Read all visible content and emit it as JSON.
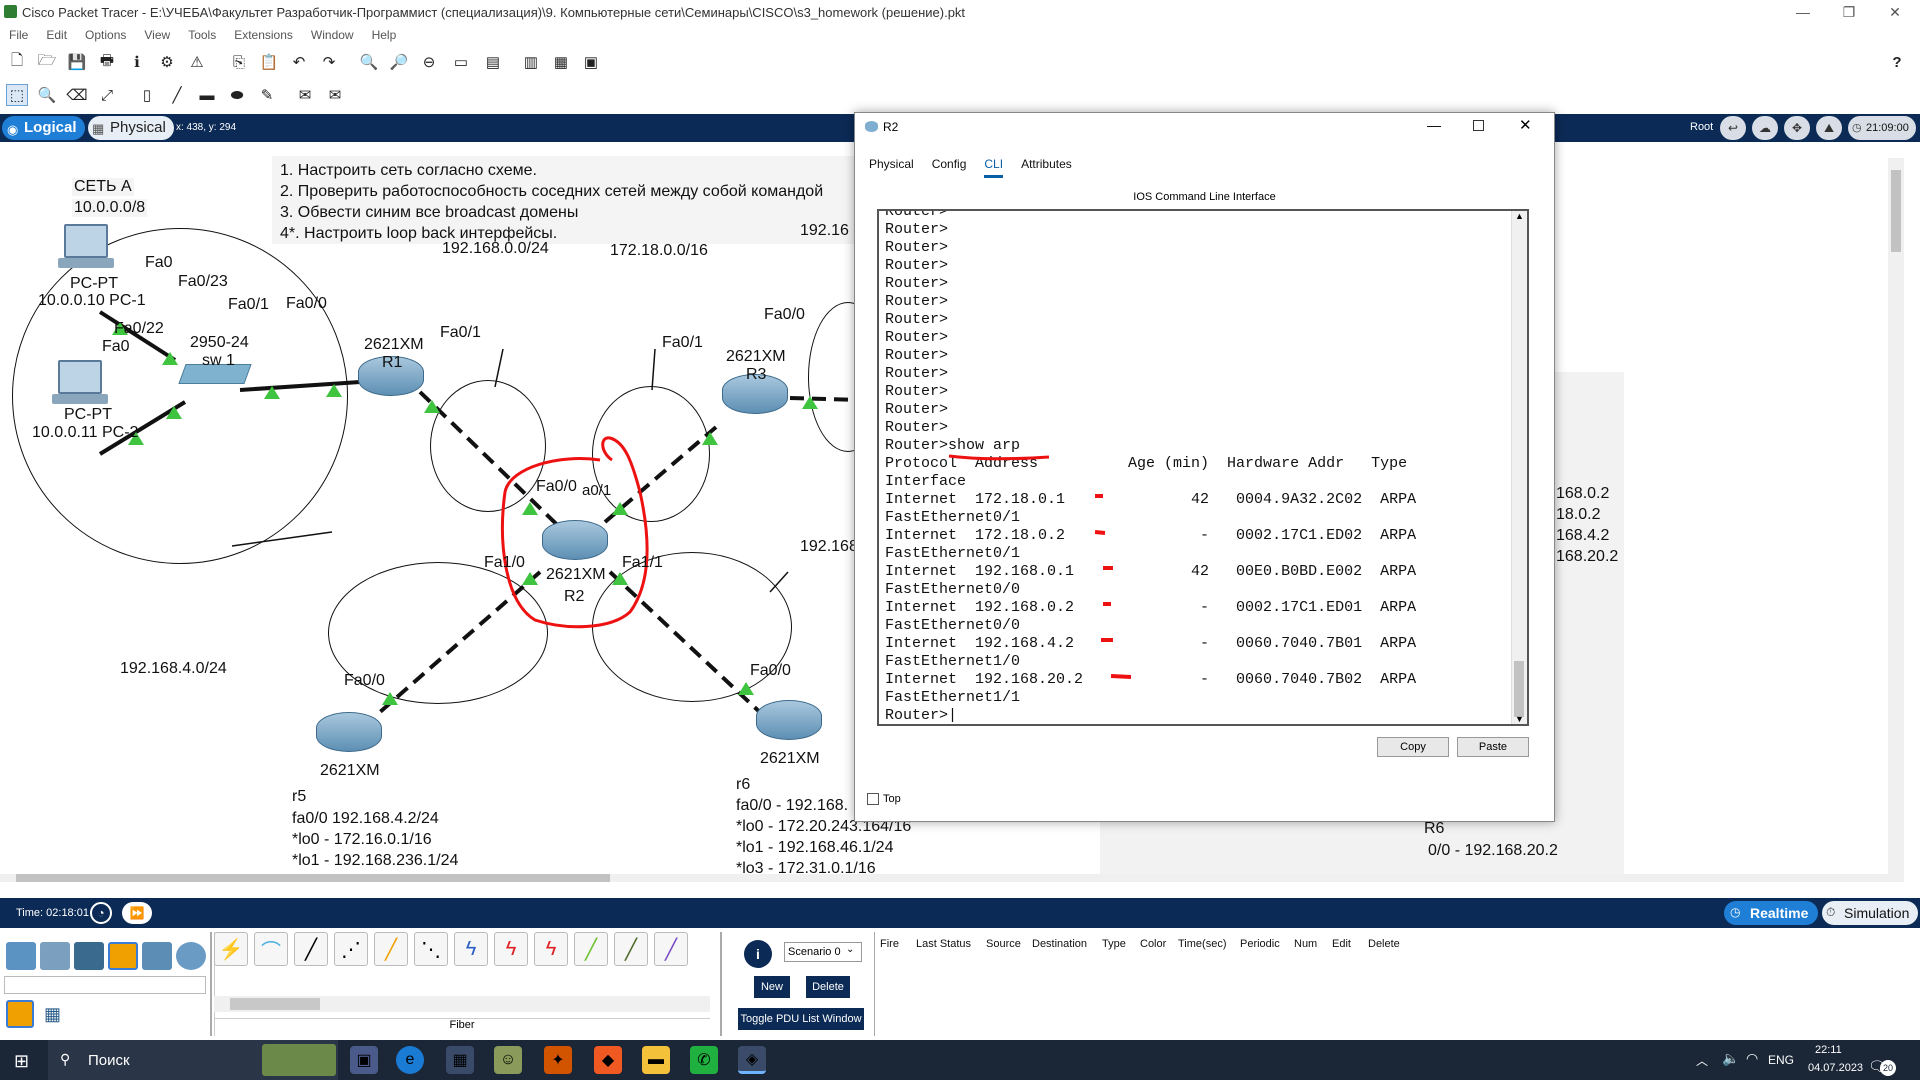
{
  "window": {
    "title": "Cisco Packet Tracer - E:\\УЧЕБА\\Факультет Разработчик-Программист (специализация)\\9. Компьютерные сети\\Семинары\\CISCO\\s3_homework (решение).pkt",
    "minimize": "—",
    "maximize": "❐",
    "close": "✕"
  },
  "menu": [
    "File",
    "Edit",
    "Options",
    "View",
    "Tools",
    "Extensions",
    "Window",
    "Help"
  ],
  "help_icon": "?",
  "logical_bar": {
    "logical_label": "Logical",
    "physical_label": "Physical",
    "coords": "x: 438, y: 294",
    "root_label": "Root",
    "clock": "21:09:00"
  },
  "notes": {
    "line1": "1. Настроить сеть согласно схеме.",
    "line2": "2. Проверить работоспособность соседних сетей между собой командой",
    "line3": "3. Обвести синим все broadcast домены",
    "line4": "4*. Настроить loop back интерфейсы."
  },
  "topology": {
    "net_a_title": "СЕТЬ А",
    "net_a_addr": "10.0.0.0/8",
    "pc1_type": "PC-PT",
    "pc1_label": "10.0.0.10 PC-1",
    "pc2_type": "PC-PT",
    "pc2_label": "10.0.0.11 PC-2",
    "pc1_port": "Fa0",
    "pc2_port": "Fa0",
    "sw_port_23": "Fa0/23",
    "sw_port_22": "Fa0/22",
    "sw_port_1": "Fa0/1",
    "sw_model": "2950-24",
    "sw_name": "sw 1",
    "r1_port": "Fa0/0",
    "r1_model": "2621XM",
    "r1_name": "R1",
    "r1_port_b": "Fa0/1",
    "net_192_0": "192.168.0.0/24",
    "net_172": "172.18.0.0/16",
    "net_192_top_right": "192.16",
    "r3_port_a": "Fa0/0",
    "r3_port_b": "Fa0/1",
    "r3_model": "2621XM",
    "r3_name": "R3",
    "r2_port_00": "Fa0/0",
    "r2_port_01": "a0/1",
    "r2_port_10": "Fa1/0",
    "r2_port_11": "Fa1/1",
    "r2_model": "2621XM",
    "r2_name": "R2",
    "net_192_mid_right": "192.168",
    "net_192_4": "192.168.4.0/24",
    "r5_port": "Fa0/0",
    "r5_model": "2621XM",
    "r5_name": "r5",
    "r5_l1": "fa0/0 192.168.4.2/24",
    "r5_l2": "*lo0 - 172.16.0.1/16",
    "r5_l3": "*lo1 - 192.168.236.1/24",
    "r6_port": "Fa0/0",
    "r6_model": "2621XM",
    "r6_name": "r6",
    "r6_l1": "fa0/0 - 192.168.",
    "r6_l2": "*lo0 - 172.20.243.164/16",
    "r6_l3": "*lo1 - 192.168.46.1/24",
    "r6_l4": "*lo3 - 172.31.0.1/16",
    "right_l1": "168.0.2",
    "right_l2": "18.0.2",
    "right_l3": "168.4.2",
    "right_l4": "168.20.2",
    "right_r6": "R6",
    "right_r6_addr": "0/0 - 192.168.20.2"
  },
  "dialog": {
    "title": "R2",
    "tabs": [
      "Physical",
      "Config",
      "CLI",
      "Attributes"
    ],
    "active_tab": "CLI",
    "cli_header": "IOS Command Line Interface",
    "cli_text": "Router>\nRouter>\nRouter>\nRouter>\nRouter>\nRouter>\nRouter>\nRouter>\nRouter>\nRouter>\nRouter>\nRouter>\nRouter>\nRouter>show arp\nProtocol  Address          Age (min)  Hardware Addr   Type\nInterface\nInternet  172.18.0.1              42   0004.9A32.2C02  ARPA\nFastEthernet0/1\nInternet  172.18.0.2               -   0002.17C1.ED02  ARPA\nFastEthernet0/1\nInternet  192.168.0.1             42   00E0.B0BD.E002  ARPA\nFastEthernet0/0\nInternet  192.168.0.2              -   0002.17C1.ED01  ARPA\nFastEthernet0/0\nInternet  192.168.4.2              -   0060.7040.7B01  ARPA\nFastEthernet1/0\nInternet  192.168.20.2             -   0060.7040.7B02  ARPA\nFastEthernet1/1\nRouter>|",
    "copy_label": "Copy",
    "paste_label": "Paste",
    "top_label": "Top"
  },
  "sim_bar": {
    "time": "Time: 02:18:01",
    "realtime_label": "Realtime",
    "simulation_label": "Simulation"
  },
  "bottom_panel": {
    "fiber_label": "Fiber",
    "scenario": "Scenario 0",
    "new_label": "New",
    "delete_label": "Delete",
    "toggle_label": "Toggle PDU List Window",
    "pdu_headers": [
      "Fire",
      "Last Status",
      "Source",
      "Destination",
      "Type",
      "Color",
      "Time(sec)",
      "Periodic",
      "Num",
      "Edit",
      "Delete"
    ]
  },
  "taskbar": {
    "search_label": "Поиск",
    "lang": "ENG",
    "time": "22:11",
    "date": "04.07.2023",
    "notif": "20"
  }
}
